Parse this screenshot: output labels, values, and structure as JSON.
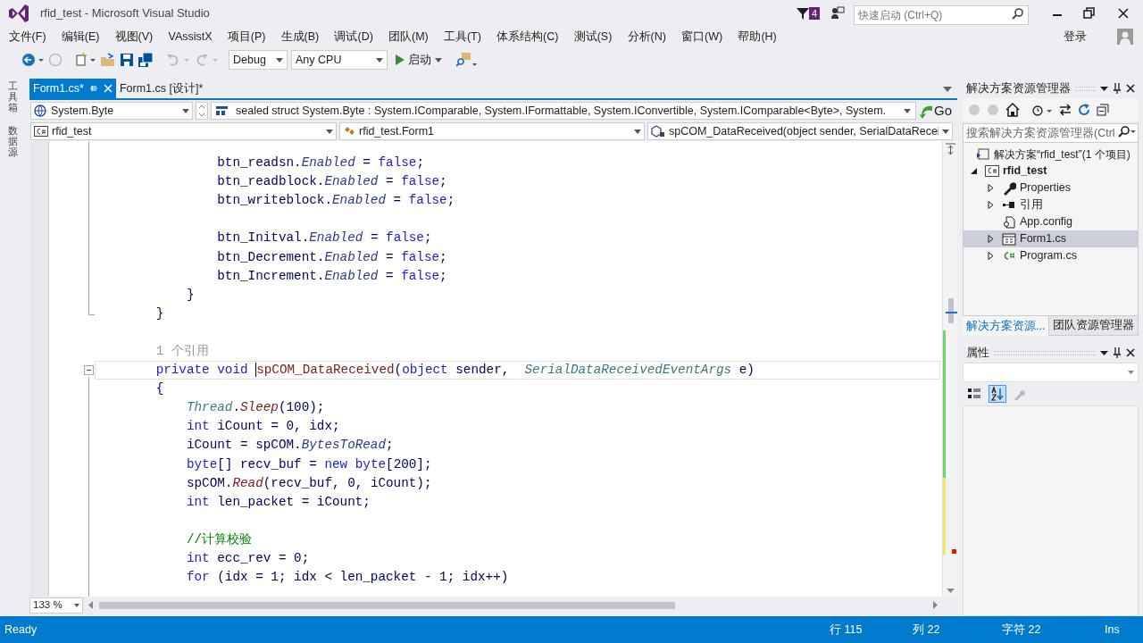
{
  "window": {
    "title": "rfid_test - Microsoft Visual Studio",
    "notification_count": "4",
    "quick_launch": {
      "placeholder": "快速启动 (Ctrl+Q)"
    }
  },
  "menu": [
    "文件(F)",
    "编辑(E)",
    "视图(V)",
    "VAssistX",
    "项目(P)",
    "生成(B)",
    "调试(D)",
    "团队(M)",
    "工具(T)",
    "体系结构(C)",
    "测试(S)",
    "分析(N)",
    "窗口(W)",
    "帮助(H)"
  ],
  "sign_in": "登录",
  "toolbar": {
    "configuration": "Debug",
    "platform": "Any CPU",
    "start": "启动"
  },
  "side_tabs": [
    "工具箱",
    "数据源"
  ],
  "doc_tabs": [
    {
      "label": "Form1.cs*",
      "selected": true
    },
    {
      "label": "Form1.cs [设计]*",
      "selected": false
    }
  ],
  "nav_bar": {
    "type": "System.Byte",
    "member_info": "sealed struct System.Byte : System.IComparable, System.IFormattable, System.IConvertible, System.IComparable<Byte>, System.",
    "go": "Go",
    "project": "rfid_test",
    "class": "rfid_test.Form1",
    "member": "spCOM_DataReceived(object sender, SerialDataRecei"
  },
  "editor": {
    "zoom": "133 %",
    "lines": [
      {
        "kind": "code",
        "tokens": [
          {
            "kind": "plain",
            "text": "                btn_readsn."
          },
          {
            "kind": "property",
            "text": "Enabled"
          },
          {
            "kind": "plain",
            "text": " = "
          },
          {
            "kind": "keyword",
            "text": "false"
          },
          {
            "kind": "plain",
            "text": ";"
          }
        ]
      },
      {
        "kind": "code",
        "tokens": [
          {
            "kind": "plain",
            "text": "                btn_readblock."
          },
          {
            "kind": "property",
            "text": "Enabled"
          },
          {
            "kind": "plain",
            "text": " = "
          },
          {
            "kind": "keyword",
            "text": "false"
          },
          {
            "kind": "plain",
            "text": ";"
          }
        ]
      },
      {
        "kind": "code",
        "tokens": [
          {
            "kind": "plain",
            "text": "                btn_writeblock."
          },
          {
            "kind": "property",
            "text": "Enabled"
          },
          {
            "kind": "plain",
            "text": " = "
          },
          {
            "kind": "keyword",
            "text": "false"
          },
          {
            "kind": "plain",
            "text": ";"
          }
        ]
      },
      {
        "kind": "blank"
      },
      {
        "kind": "code",
        "tokens": [
          {
            "kind": "plain",
            "text": "                btn_Initval."
          },
          {
            "kind": "property",
            "text": "Enabled"
          },
          {
            "kind": "plain",
            "text": " = "
          },
          {
            "kind": "keyword",
            "text": "false"
          },
          {
            "kind": "plain",
            "text": ";"
          }
        ]
      },
      {
        "kind": "code",
        "tokens": [
          {
            "kind": "plain",
            "text": "                btn_Decrement."
          },
          {
            "kind": "property",
            "text": "Enabled"
          },
          {
            "kind": "plain",
            "text": " = "
          },
          {
            "kind": "keyword",
            "text": "false"
          },
          {
            "kind": "plain",
            "text": ";"
          }
        ]
      },
      {
        "kind": "code",
        "tokens": [
          {
            "kind": "plain",
            "text": "                btn_Increment."
          },
          {
            "kind": "property",
            "text": "Enabled"
          },
          {
            "kind": "plain",
            "text": " = "
          },
          {
            "kind": "keyword",
            "text": "false"
          },
          {
            "kind": "plain",
            "text": ";"
          }
        ]
      },
      {
        "kind": "code",
        "tokens": [
          {
            "kind": "plain",
            "text": "            }"
          }
        ]
      },
      {
        "kind": "code",
        "tokens": [
          {
            "kind": "plain",
            "text": "        }"
          }
        ]
      },
      {
        "kind": "blank"
      },
      {
        "kind": "lens",
        "tokens": [
          {
            "kind": "lens",
            "text": "        1 个引用"
          }
        ]
      },
      {
        "kind": "code",
        "current": true,
        "tokens": [
          {
            "kind": "keyword",
            "text": "        private void "
          },
          {
            "kind": "method_decl",
            "text": "spCOM_DataReceived",
            "caret": true
          },
          {
            "kind": "plain",
            "text": "("
          },
          {
            "kind": "keyword",
            "text": "object"
          },
          {
            "kind": "plain",
            "text": " sender,  "
          },
          {
            "kind": "type",
            "text": "SerialDataReceivedEventArgs"
          },
          {
            "kind": "plain",
            "text": " e)"
          }
        ]
      },
      {
        "kind": "code",
        "tokens": [
          {
            "kind": "plain",
            "text": "        {"
          }
        ]
      },
      {
        "kind": "code",
        "tokens": [
          {
            "kind": "type",
            "text": "            Thread"
          },
          {
            "kind": "plain",
            "text": "."
          },
          {
            "kind": "method",
            "text": "Sleep"
          },
          {
            "kind": "plain",
            "text": "(100);"
          }
        ]
      },
      {
        "kind": "code",
        "tokens": [
          {
            "kind": "keyword",
            "text": "            int"
          },
          {
            "kind": "plain",
            "text": " iCount = 0, idx;"
          }
        ]
      },
      {
        "kind": "code",
        "tokens": [
          {
            "kind": "plain",
            "text": "            iCount = spCOM."
          },
          {
            "kind": "property",
            "text": "BytesToRead"
          },
          {
            "kind": "plain",
            "text": ";"
          }
        ]
      },
      {
        "kind": "code",
        "tokens": [
          {
            "kind": "keyword",
            "text": "            byte"
          },
          {
            "kind": "plain",
            "text": "[] recv_buf = "
          },
          {
            "kind": "keyword",
            "text": "new byte"
          },
          {
            "kind": "plain",
            "text": "[200];"
          }
        ]
      },
      {
        "kind": "code",
        "tokens": [
          {
            "kind": "plain",
            "text": "            spCOM."
          },
          {
            "kind": "method",
            "text": "Read"
          },
          {
            "kind": "plain",
            "text": "(recv_buf, 0, iCount);"
          }
        ]
      },
      {
        "kind": "code",
        "tokens": [
          {
            "kind": "keyword",
            "text": "            int"
          },
          {
            "kind": "plain",
            "text": " len_packet = iCount;"
          }
        ]
      },
      {
        "kind": "blank"
      },
      {
        "kind": "code",
        "tokens": [
          {
            "kind": "comment",
            "text": "            //计算校验"
          }
        ]
      },
      {
        "kind": "code",
        "tokens": [
          {
            "kind": "keyword",
            "text": "            int"
          },
          {
            "kind": "plain",
            "text": " ecc_rev = 0;"
          }
        ]
      },
      {
        "kind": "code",
        "tokens": [
          {
            "kind": "keyword",
            "text": "            for"
          },
          {
            "kind": "plain",
            "text": " (idx = 1; idx < len_packet - 1; idx++)"
          }
        ]
      }
    ]
  },
  "solution_explorer": {
    "title": "解决方案资源管理器",
    "search": {
      "placeholder": "搜索解决方案资源管理器(Ctrl"
    },
    "tree": [
      {
        "label": "解决方案“rfid_test”(1 个项目)",
        "kind": "solution",
        "selected": false,
        "children": [
          {
            "label": "rfid_test",
            "kind": "project",
            "expanded": true,
            "selected": false,
            "children": [
              {
                "label": "Properties",
                "kind": "properties",
                "expanded": false,
                "selected": false
              },
              {
                "label": "引用",
                "kind": "references",
                "expanded": false,
                "selected": false
              },
              {
                "label": "App.config",
                "kind": "config",
                "selected": false
              },
              {
                "label": "Form1.cs",
                "kind": "form",
                "expanded": false,
                "selected": true
              },
              {
                "label": "Program.cs",
                "kind": "csharp",
                "expanded": false,
                "selected": false
              }
            ]
          }
        ]
      }
    ]
  },
  "panel_tabs": [
    {
      "label": "解决方案资源...",
      "selected": true
    },
    {
      "label": "团队资源管理器",
      "selected": false
    }
  ],
  "properties": {
    "title": "属性"
  },
  "status_bar": {
    "message": "Ready",
    "line": "行 115",
    "column": "列 22",
    "char": "字符 22",
    "mode": "Ins"
  }
}
